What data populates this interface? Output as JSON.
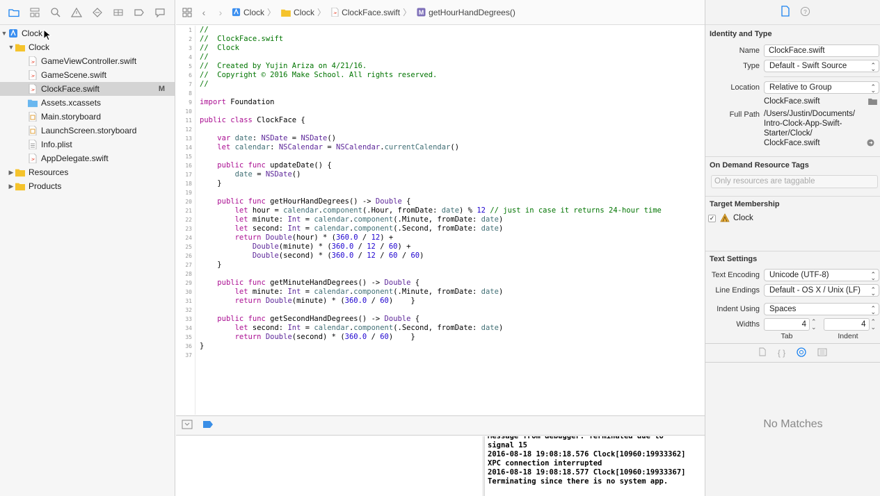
{
  "navigator": {
    "toolbar_icons": [
      "folder-icon",
      "hierarchy-icon",
      "search-icon",
      "warning-icon",
      "test-icon",
      "debug-icon",
      "breakpoint-icon",
      "report-icon"
    ],
    "items": [
      {
        "label": "Clock",
        "indent": 0,
        "expanded": true,
        "icon": "project-icon",
        "disclosure": "▼"
      },
      {
        "label": "Clock",
        "indent": 1,
        "expanded": true,
        "icon": "folder-icon",
        "disclosure": "▼"
      },
      {
        "label": "GameViewController.swift",
        "indent": 2,
        "icon": "swift-file-icon"
      },
      {
        "label": "GameScene.swift",
        "indent": 2,
        "icon": "swift-file-icon"
      },
      {
        "label": "ClockFace.swift",
        "indent": 2,
        "icon": "swift-file-icon",
        "selected": true,
        "badge": "M"
      },
      {
        "label": "Assets.xcassets",
        "indent": 2,
        "icon": "assets-folder-icon"
      },
      {
        "label": "Main.storyboard",
        "indent": 2,
        "icon": "storyboard-icon"
      },
      {
        "label": "LaunchScreen.storyboard",
        "indent": 2,
        "icon": "storyboard-icon"
      },
      {
        "label": "Info.plist",
        "indent": 2,
        "icon": "plist-icon"
      },
      {
        "label": "AppDelegate.swift",
        "indent": 2,
        "icon": "swift-file-icon"
      },
      {
        "label": "Resources",
        "indent": 1,
        "icon": "folder-icon",
        "disclosure": "▶"
      },
      {
        "label": "Products",
        "indent": 1,
        "icon": "folder-icon",
        "disclosure": "▶"
      }
    ]
  },
  "jumpbar": {
    "crumbs": [
      "Clock",
      "Clock",
      "ClockFace.swift",
      "getHourHandDegrees()"
    ]
  },
  "code": {
    "lines": [
      "//",
      "//  ClockFace.swift",
      "//  Clock",
      "//",
      "//  Created by Yujin Ariza on 4/21/16.",
      "//  Copyright © 2016 Make School. All rights reserved.",
      "//",
      "",
      "import Foundation",
      "",
      "public class ClockFace {",
      "",
      "    var date: NSDate = NSDate()",
      "    let calendar: NSCalendar = NSCalendar.currentCalendar()",
      "",
      "    public func updateDate() {",
      "        date = NSDate()",
      "    }",
      "",
      "    public func getHourHandDegrees() -> Double {",
      "        let hour = calendar.component(.Hour, fromDate: date) % 12 // just in case it returns 24-hour time",
      "        let minute: Int = calendar.component(.Minute, fromDate: date)",
      "        let second: Int = calendar.component(.Second, fromDate: date)",
      "        return Double(hour) * (360.0 / 12) +",
      "            Double(minute) * (360.0 / 12 / 60) +",
      "            Double(second) * (360.0 / 12 / 60 / 60)",
      "    }",
      "",
      "    public func getMinuteHandDegrees() -> Double {",
      "        let minute: Int = calendar.component(.Minute, fromDate: date)",
      "        return Double(minute) * (360.0 / 60)    }",
      "",
      "    public func getSecondHandDegrees() -> Double {",
      "        let second: Int = calendar.component(.Second, fromDate: date)",
      "        return Double(second) * (360.0 / 60)    }",
      "}",
      ""
    ]
  },
  "console": {
    "lines": [
      "Message from debugger: Terminated due to",
      "signal 15",
      "2016-08-18 19:08:18.576 Clock[10960:19933362]",
      "XPC connection interrupted",
      "2016-08-18 19:08:18.577 Clock[10960:19933367]",
      "Terminating since there is no system app."
    ]
  },
  "inspector": {
    "identity_title": "Identity and Type",
    "name_label": "Name",
    "name_value": "ClockFace.swift",
    "type_label": "Type",
    "type_value": "Default - Swift Source",
    "location_label": "Location",
    "location_value": "Relative to Group",
    "location_file": "ClockFace.swift",
    "fullpath_label": "Full Path",
    "fullpath_lines": [
      "/Users/Justin/Documents/",
      "Intro-Clock-App-Swift-",
      "Starter/Clock/",
      "ClockFace.swift"
    ],
    "odr_title": "On Demand Resource Tags",
    "odr_placeholder": "Only resources are taggable",
    "target_title": "Target Membership",
    "target_name": "Clock",
    "text_title": "Text Settings",
    "encoding_label": "Text Encoding",
    "encoding_value": "Unicode (UTF-8)",
    "line_endings_label": "Line Endings",
    "line_endings_value": "Default - OS X / Unix (LF)",
    "indent_label": "Indent Using",
    "indent_value": "Spaces",
    "widths_label": "Widths",
    "tab_width": "4",
    "indent_width": "4",
    "tab_caption": "Tab",
    "indent_caption": "Indent",
    "no_matches": "No Matches"
  }
}
